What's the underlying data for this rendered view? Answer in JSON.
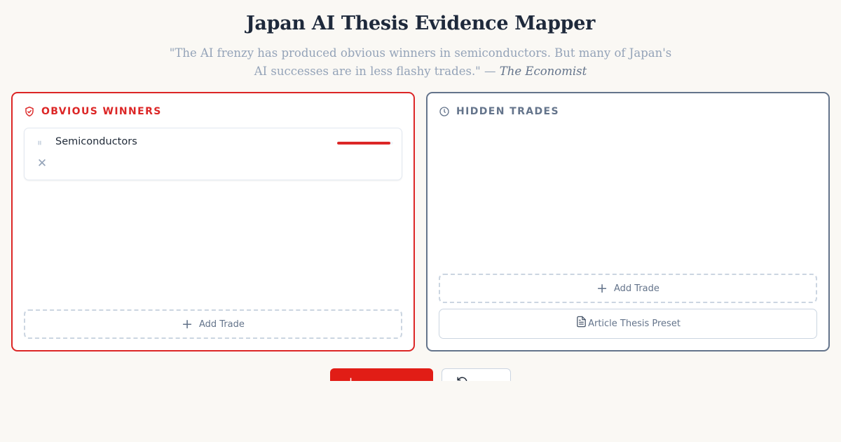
{
  "header": {
    "title": "Japan AI Thesis Evidence Mapper",
    "quote_text": "\"The AI frenzy has produced obvious winners in semiconductors. But many of Japan's AI successes are in less flashy trades.\" —",
    "quote_source": "The Economist"
  },
  "columns": {
    "obvious": {
      "title": "OBVIOUS WINNERS",
      "icon": "shield-check-icon",
      "accent": "#dc2626",
      "trades": [
        {
          "name": "Semiconductors",
          "strength": 0.95
        }
      ],
      "add_label": "Add Trade"
    },
    "hidden": {
      "title": "HIDDEN TRADES",
      "icon": "clock-icon",
      "accent": "#64748b",
      "trades": [],
      "add_label": "Add Trade",
      "preset_label": "Article Thesis Preset"
    }
  },
  "colors": {
    "background": "#faf8f4",
    "primary_button": "#e11d16"
  }
}
